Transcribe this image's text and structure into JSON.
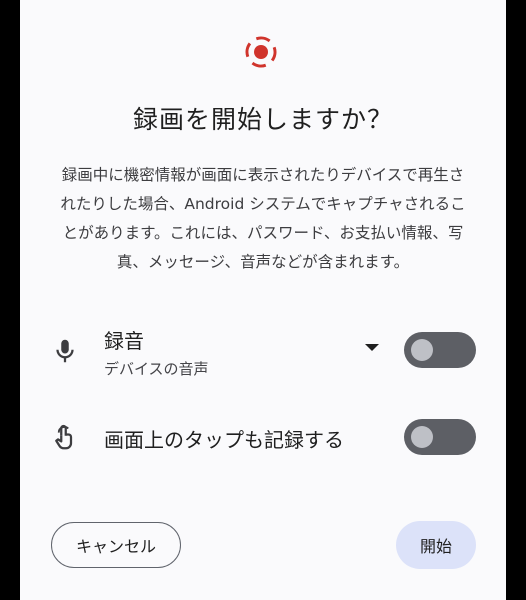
{
  "dialog": {
    "title": "録画を開始しますか？",
    "description": "録画中に機密情報が画面に表示されたりデバイスで再生されたりした場合、Android システムでキャプチャされることがあります。これには、パスワード、お支払い情報、写真、メッセージ、音声などが含まれます。",
    "audio": {
      "label": "録音",
      "source": "デバイスの音声",
      "enabled": false
    },
    "show_taps": {
      "label": "画面上のタップも記録する",
      "enabled": false
    },
    "cancel_label": "キャンセル",
    "start_label": "開始"
  },
  "icons": {
    "record": "screen-record-icon",
    "microphone": "microphone-icon",
    "touch": "touch-icon",
    "dropdown": "dropdown-arrow-icon"
  },
  "colors": {
    "record": "#d0342c",
    "dialog_bg": "#fafafc",
    "toggle_off": "#5d5f65",
    "start_button_bg": "#dce2f9"
  }
}
